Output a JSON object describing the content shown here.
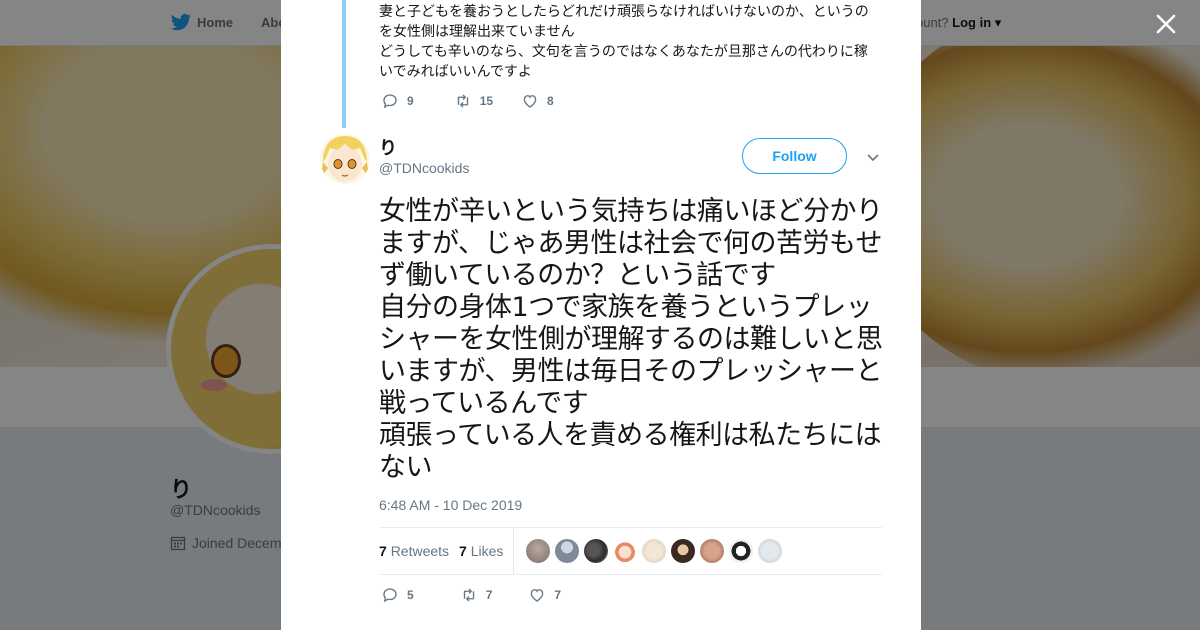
{
  "nav": {
    "home_label": "Home",
    "about_label": "Abo",
    "have_account": "ccount?",
    "login_label": "Log in"
  },
  "profile": {
    "name": "り",
    "handle": "@TDNcookids",
    "joined": "Joined Decem"
  },
  "previous_tweet": {
    "text": "妻と子どもを養おうとしたらどれだけ頑張らなければいけないのか、というのを女性側は理解出来ていません\nどうしても辛いのなら、文句を言うのではなくあなたが旦那さんの代わりに稼いでみればいいんですよ",
    "replies": "9",
    "retweets": "15",
    "likes": "8"
  },
  "tweet": {
    "author_name": "り",
    "author_handle": "@TDNcookids",
    "follow_label": "Follow",
    "text": "女性が辛いという気持ちは痛いほど分かりますが、じゃあ男性は社会で何の苦労もせず働いているのか？という話です\n自分の身体1つで家族を養うというプレッシャーを女性側が理解するのは難しいと思いますが、男性は毎日そのプレッシャーと戦っているんです\n頑張っている人を責める権利は私たちにはない",
    "timestamp": "6:48 AM - 10 Dec 2019",
    "retweet_count": "7",
    "retweets_label": "Retweets",
    "like_count": "7",
    "likes_label": "Likes",
    "replies": "5",
    "retweets": "7",
    "likes": "7"
  },
  "colors": {
    "accent": "#1da1f2",
    "thread_line": "#8ecdf8",
    "muted": "#657786"
  },
  "icons": [
    "twitter-bird-icon",
    "close-icon",
    "reply-icon",
    "retweet-icon",
    "heart-icon",
    "chevron-down-icon",
    "calendar-icon"
  ]
}
